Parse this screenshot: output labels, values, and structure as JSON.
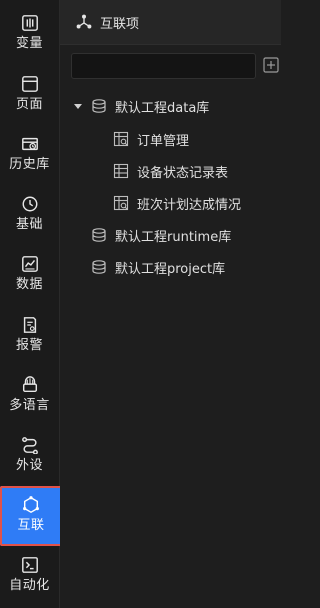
{
  "sidebar": {
    "items": [
      {
        "label": "变量",
        "icon": "variable-icon"
      },
      {
        "label": "页面",
        "icon": "page-icon"
      },
      {
        "label": "历史库",
        "icon": "history-db-icon"
      },
      {
        "label": "基础",
        "icon": "clock-base-icon"
      },
      {
        "label": "数据",
        "icon": "data-chart-icon"
      },
      {
        "label": "报警",
        "icon": "alarm-doc-icon"
      },
      {
        "label": "多语言",
        "icon": "language-icon"
      },
      {
        "label": "外设",
        "icon": "device-icon"
      },
      {
        "label": "互联",
        "icon": "connect-icon",
        "active": true
      },
      {
        "label": "自动化",
        "icon": "terminal-icon"
      }
    ]
  },
  "panel": {
    "title": "互联项",
    "search": {
      "value": "",
      "placeholder": ""
    },
    "tree": [
      {
        "label": "默认工程data库",
        "expanded": true,
        "children": [
          {
            "label": "订单管理"
          },
          {
            "label": "设备状态记录表"
          },
          {
            "label": "班次计划达成情况"
          }
        ]
      },
      {
        "label": "默认工程runtime库"
      },
      {
        "label": "默认工程project库"
      }
    ]
  },
  "colors": {
    "accent": "#2f7cf6",
    "active_border": "#e0524a",
    "background": "#1e1e1e",
    "sidebar": "#1b1b1b"
  }
}
